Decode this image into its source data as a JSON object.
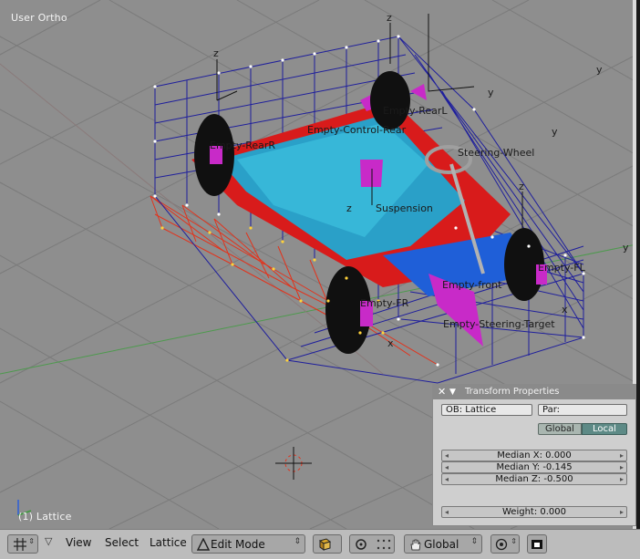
{
  "viewport": {
    "view_name": "User Ortho",
    "active_object": "(1) Lattice",
    "object_labels": {
      "control_rear": "Empty-Control-Rear",
      "steering_wheel": "Steering-Wheel",
      "suspension": "Suspension",
      "rear_r": "Empty-RearR",
      "rear_l": "Empty-RearL",
      "front_l": "Empty-FL",
      "front_r": "Empty-FR",
      "steering_target": "Empty-Steering-Target",
      "empty_front": "Empty-front"
    },
    "axis_labels": {
      "z": "z",
      "y": "y",
      "x": "x"
    },
    "colors": {
      "background": "#8e8e8e",
      "lattice": "#1f1f9c",
      "lattice_selected": "#e2331c",
      "chassis_red": "#d81b1b",
      "chassis_blue": "#2b8fc9",
      "wheel_black": "#101010",
      "hub_magenta": "#c82ac8"
    }
  },
  "transform_panel": {
    "title": "Transform Properties",
    "object_field": "OB: Lattice",
    "parent_field": "Par:",
    "global_label": "Global",
    "local_label": "Local",
    "median_x": "Median X: 0.000",
    "median_y": "Median Y: -0.145",
    "median_z": "Median Z: -0.500",
    "weight": "Weight: 0.000"
  },
  "header": {
    "menus": {
      "view": "View",
      "select": "Select",
      "lattice": "Lattice"
    },
    "mode": "Edit Mode",
    "orientation": "Global",
    "icons": {
      "editor_type": "grid-icon",
      "mode": "triangle-icon",
      "shading": "cube-icon",
      "pivot": "pivot-icon",
      "manipulator": "hand-icon",
      "snap": "target-icon",
      "render": "camera-icon"
    }
  }
}
